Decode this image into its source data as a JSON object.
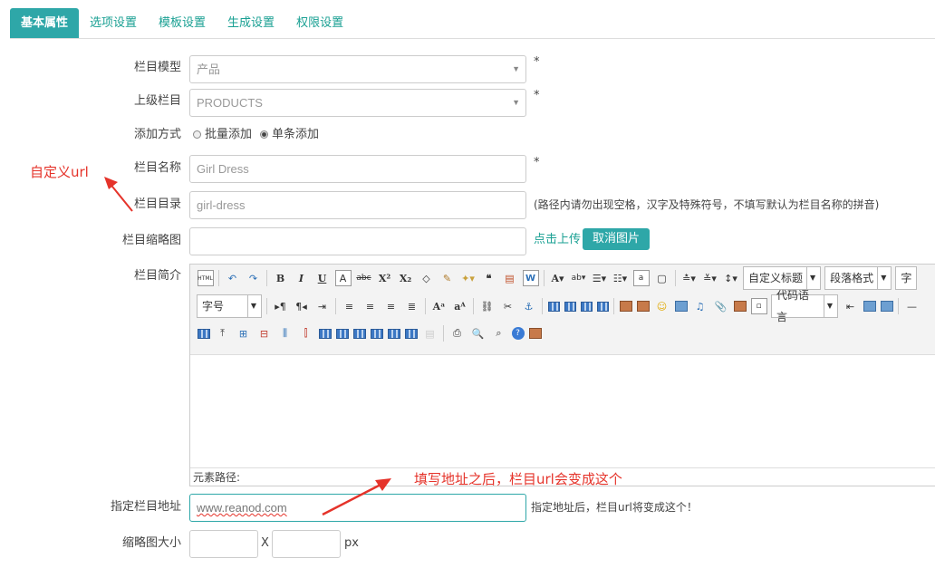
{
  "tabs": [
    "基本属性",
    "选项设置",
    "模板设置",
    "生成设置",
    "权限设置"
  ],
  "form": {
    "model": {
      "label": "栏目模型",
      "value": "产品",
      "required": "*"
    },
    "parent": {
      "label": "上级栏目",
      "value": "PRODUCTS",
      "required": "*"
    },
    "add_mode": {
      "label": "添加方式",
      "option_batch": "批量添加",
      "option_single": "单条添加",
      "selected": "单条添加"
    },
    "name": {
      "label": "栏目名称",
      "value": "Girl Dress",
      "required": "*"
    },
    "dir": {
      "label": "栏目目录",
      "value": "girl-dress",
      "hint": "(路径内请勿出现空格，汉字及特殊符号，不填写默认为栏目名称的拼音)"
    },
    "thumb": {
      "label": "栏目缩略图",
      "upload": "点击上传",
      "cancel": "取消图片"
    },
    "intro": {
      "label": "栏目简介"
    },
    "url": {
      "label": "指定栏目地址",
      "value": "www.reanod.com",
      "hint": "指定地址后，栏目url将变成这个！"
    },
    "thumb_size": {
      "label": "缩略图大小",
      "x": "X",
      "unit": "px"
    }
  },
  "editor": {
    "combo_title": "自定义标题",
    "combo_para": "段落格式",
    "combo_font": "字",
    "combo_size": "字号",
    "combo_code": "代码语言",
    "footer": "元素路径:"
  },
  "annotations": {
    "custom_url": "自定义url",
    "after_fill": "填写地址之后，栏目url会变成这个"
  },
  "colors": {
    "accent": "#2ea7a8",
    "annotation": "#e5332a"
  }
}
